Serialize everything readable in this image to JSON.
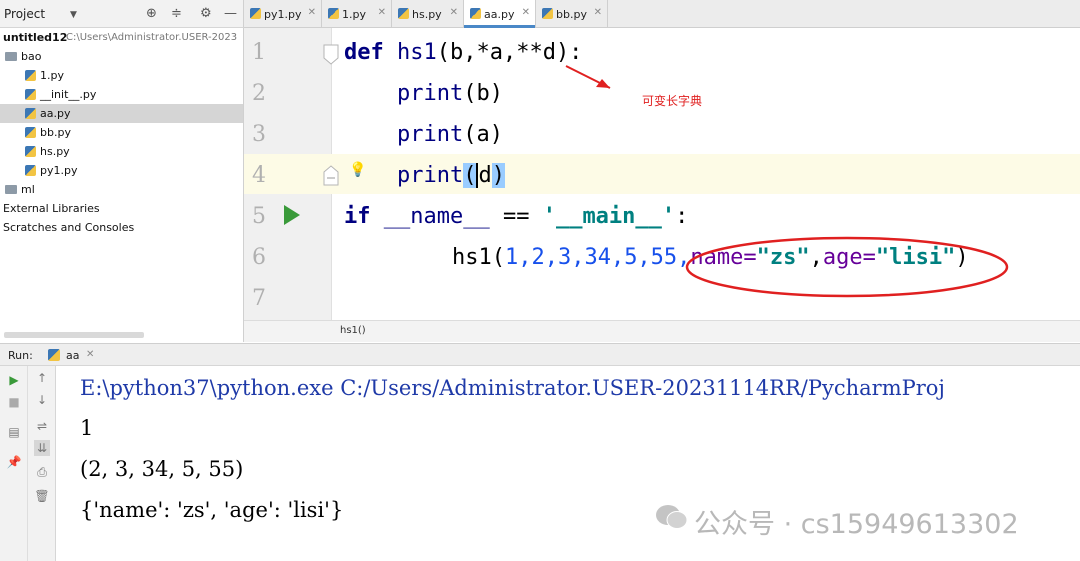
{
  "project_panel": {
    "title": "Project",
    "root_name": "untitled12",
    "root_path": "C:\\Users\\Administrator.USER-2023",
    "items": [
      {
        "label": "bao",
        "kind": "folder"
      },
      {
        "label": "1.py",
        "kind": "file"
      },
      {
        "label": "__init__.py",
        "kind": "file"
      },
      {
        "label": "aa.py",
        "kind": "file",
        "selected": true
      },
      {
        "label": "bb.py",
        "kind": "file"
      },
      {
        "label": "hs.py",
        "kind": "file"
      },
      {
        "label": "py1.py",
        "kind": "file"
      },
      {
        "label": "ml",
        "kind": "folder"
      },
      {
        "label": "External Libraries",
        "kind": "node"
      },
      {
        "label": "Scratches and Consoles",
        "kind": "node"
      }
    ]
  },
  "editor_tabs": [
    {
      "label": "py1.py"
    },
    {
      "label": "1.py"
    },
    {
      "label": "hs.py"
    },
    {
      "label": "aa.py",
      "active": true
    },
    {
      "label": "bb.py"
    }
  ],
  "editor": {
    "line_numbers": [
      "1",
      "2",
      "3",
      "4",
      "5",
      "6",
      "7"
    ],
    "annotation": "可变长字典",
    "breadcrumb": "hs1()",
    "lines": {
      "l1": {
        "kw": "def",
        "name": " hs1",
        "rest": "(b,*a,**d):"
      },
      "l2": {
        "fn": "print",
        "rest": "(b)"
      },
      "l3": {
        "fn": "print",
        "rest": "(a)"
      },
      "l4": {
        "fn": "print",
        "open": "(",
        "arg": "d",
        "close": ")"
      },
      "l5": {
        "kw": "if",
        "sp": " ",
        "dunder": "__name__",
        "op": " == ",
        "str": "'__main__'",
        "colon": ":"
      },
      "l6": {
        "call": "hs1(",
        "nums": "1,2,3,34,5,55,",
        "k1": "name=",
        "v1": "\"zs\"",
        "comma": ",",
        "k2": "age=",
        "v2": "\"lisi\"",
        "close": ")"
      }
    }
  },
  "run_panel": {
    "label": "Run:",
    "tab": "aa",
    "output": [
      "E:\\python37\\python.exe C:/Users/Administrator.USER-20231114RR/PycharmProj",
      "1",
      "(2, 3, 34, 5, 55)",
      "{'name': 'zs', 'age': 'lisi'}"
    ]
  },
  "watermark": "公众号 · cs15949613302",
  "colors": {
    "keyword": "#000080",
    "number": "#1750eb",
    "string": "#008080",
    "kwarg": "#660099",
    "annotation": "#e02020",
    "run_green": "#3a9a3a"
  }
}
